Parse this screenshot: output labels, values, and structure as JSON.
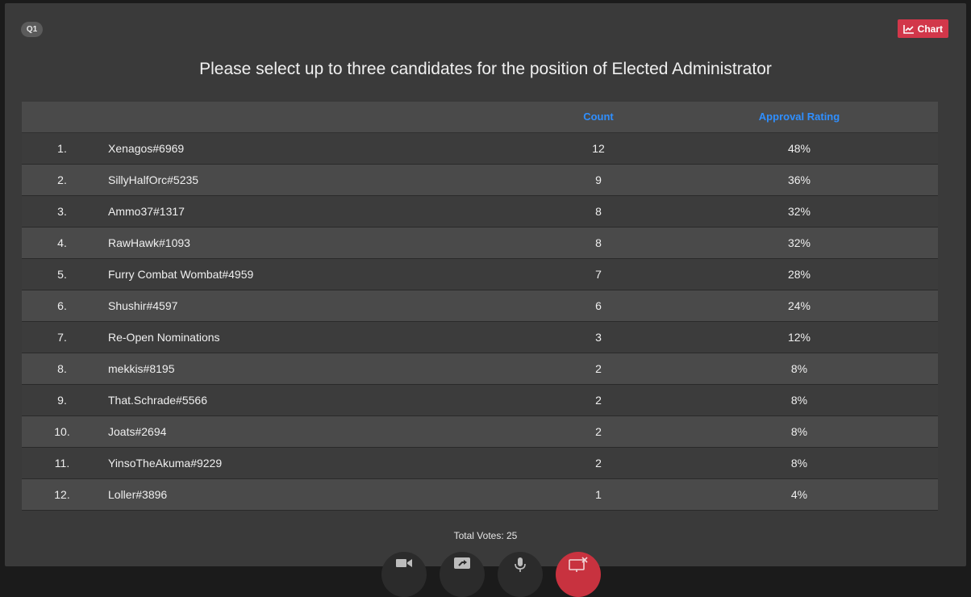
{
  "badge": "Q1",
  "chart_button": {
    "label": "Chart",
    "icon": "line-chart-icon",
    "color": "#d2374a"
  },
  "title": "Please select up to three candidates for the position of Elected Administrator",
  "table": {
    "headers": {
      "rank": "",
      "name": "",
      "count": "Count",
      "rating": "Approval Rating"
    },
    "rows": [
      {
        "rank": "1.",
        "name": "Xenagos#6969",
        "count": "12",
        "rating": "48%"
      },
      {
        "rank": "2.",
        "name": "SillyHalfOrc#5235",
        "count": "9",
        "rating": "36%"
      },
      {
        "rank": "3.",
        "name": "Ammo37#1317",
        "count": "8",
        "rating": "32%"
      },
      {
        "rank": "4.",
        "name": "RawHawk#1093",
        "count": "8",
        "rating": "32%"
      },
      {
        "rank": "5.",
        "name": "Furry Combat Wombat#4959",
        "count": "7",
        "rating": "28%"
      },
      {
        "rank": "6.",
        "name": "Shushir#4597",
        "count": "6",
        "rating": "24%"
      },
      {
        "rank": "7.",
        "name": "Re-Open Nominations",
        "count": "3",
        "rating": "12%"
      },
      {
        "rank": "8.",
        "name": "mekkis#8195",
        "count": "2",
        "rating": "8%"
      },
      {
        "rank": "9.",
        "name": "That.Schrade#5566",
        "count": "2",
        "rating": "8%"
      },
      {
        "rank": "10.",
        "name": "Joats#2694",
        "count": "2",
        "rating": "8%"
      },
      {
        "rank": "11.",
        "name": "YinsoTheAkuma#9229",
        "count": "2",
        "rating": "8%"
      },
      {
        "rank": "12.",
        "name": "Loller#3896",
        "count": "1",
        "rating": "4%"
      }
    ]
  },
  "total_votes": "Total Votes: 25",
  "dock": {
    "buttons": [
      {
        "icon": "camera-icon"
      },
      {
        "icon": "share-screen-icon"
      },
      {
        "icon": "microphone-icon"
      },
      {
        "icon": "stop-sharing-icon",
        "color": "#c8323f"
      }
    ]
  }
}
